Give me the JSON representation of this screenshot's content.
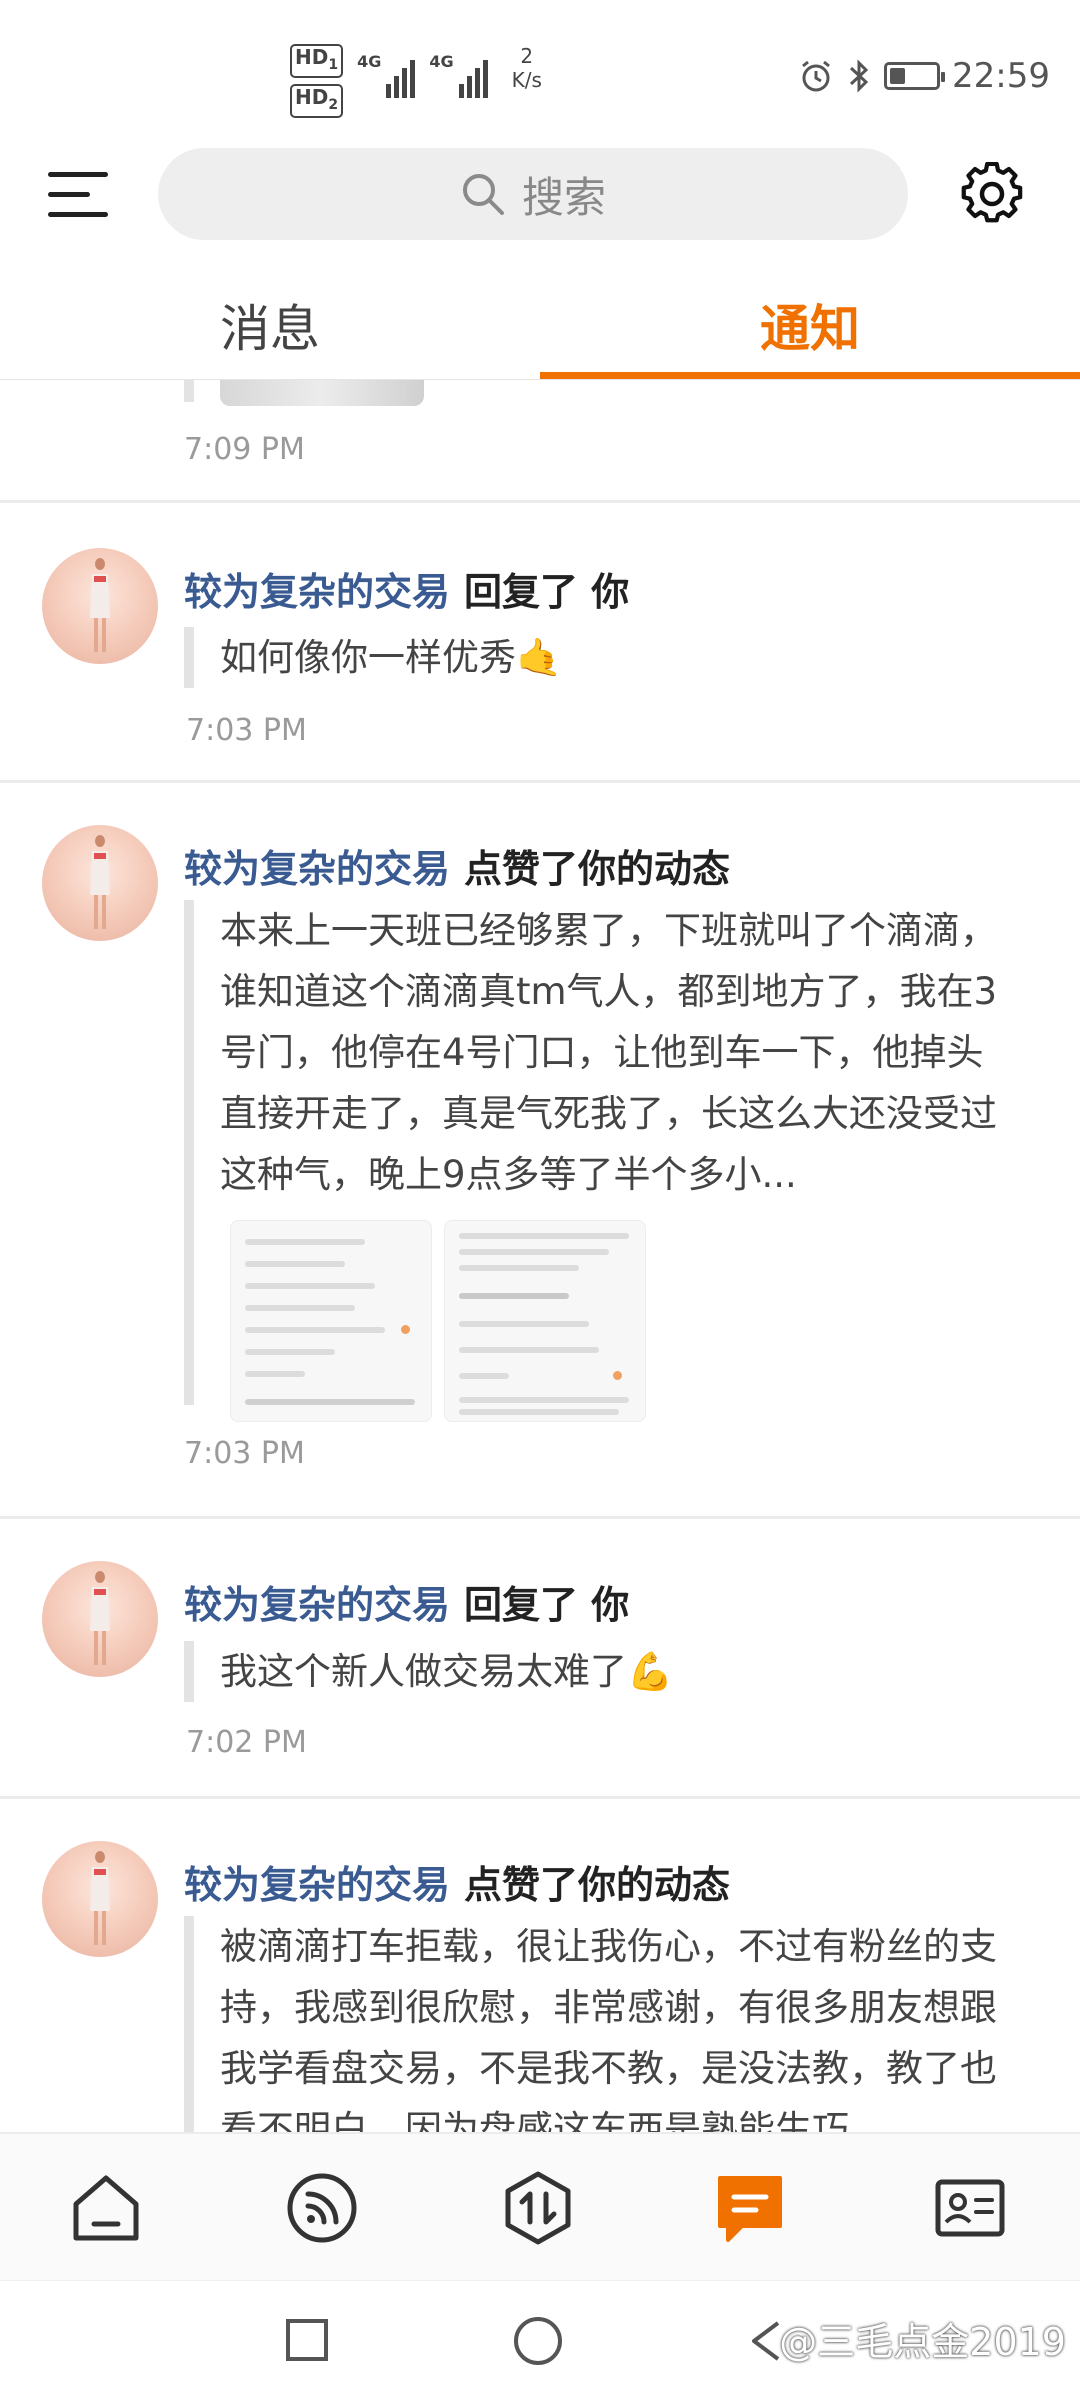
{
  "status_bar": {
    "hd1": "HD",
    "hd1_sub": "1",
    "hd2": "HD",
    "hd2_sub": "2",
    "net1": "4G",
    "net2": "4G",
    "speed_value": "2",
    "speed_unit": "K/s",
    "battery_level": 0.35,
    "time": "22:59"
  },
  "header": {
    "search_placeholder": "搜索"
  },
  "tabs": [
    {
      "label": "消息",
      "active": false
    },
    {
      "label": "通知",
      "active": true
    }
  ],
  "notifications": [
    {
      "time": "7:09 PM"
    },
    {
      "user": "较为复杂的交易",
      "action": "回复了 你",
      "content": "如何像你一样优秀",
      "emoji": "🤙",
      "time": "7:03 PM"
    },
    {
      "user": "较为复杂的交易",
      "action": "点赞了你的动态",
      "content": "本来上一天班已经够累了，下班就叫了个滴滴，谁知道这个滴滴真tm气人，都到地方了，我在3号门，他停在4号门口，让他到车一下，他掉头直接开走了，真是气死我了，长这么大还没受过这种气，晚上9点多等了半个多小...",
      "time": "7:03 PM"
    },
    {
      "user": "较为复杂的交易",
      "action": "回复了 你",
      "content": "我这个新人做交易太难了",
      "emoji": "💪",
      "time": "7:02 PM"
    },
    {
      "user": "较为复杂的交易",
      "action": "点赞了你的动态",
      "content": "被滴滴打车拒载，很让我伤心，不过有粉丝的支持，我感到很欣慰，非常感谢，有很多朋友想跟我学看盘交易，不是我不教，是没法教，教了也看不明白，因为盘感这东西是熟能生巧"
    }
  ],
  "bottom_nav": [
    {
      "icon": "home-icon",
      "active": false
    },
    {
      "icon": "feed-icon",
      "active": false
    },
    {
      "icon": "trade-icon",
      "active": false
    },
    {
      "icon": "message-icon",
      "active": true
    },
    {
      "icon": "profile-card-icon",
      "active": false
    }
  ],
  "colors": {
    "accent": "#f07000",
    "username": "#3a5a92"
  },
  "watermark": "@三毛点金2019"
}
